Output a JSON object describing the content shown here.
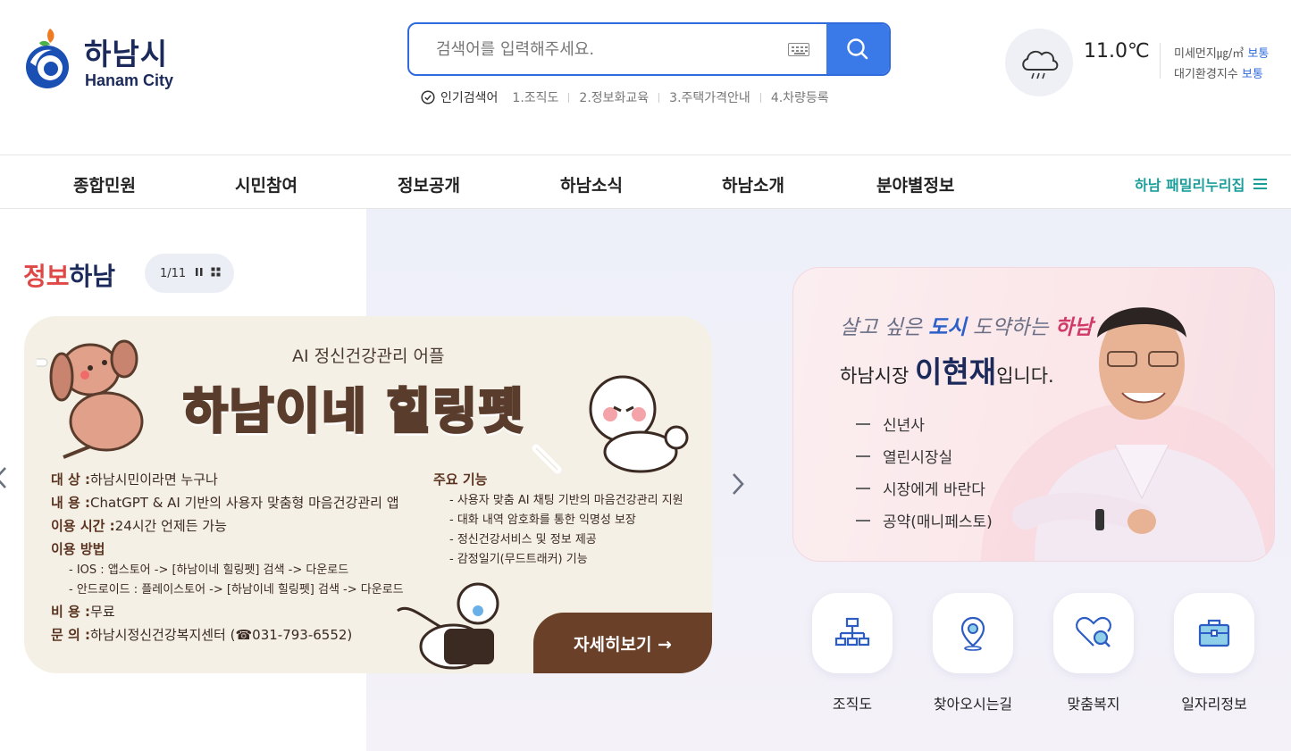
{
  "header": {
    "logo_text": "하남시",
    "logo_sub": "Hanam City",
    "search": {
      "placeholder": "검색어를 입력해주세요.",
      "popular_label": "인기검색어",
      "popular_keywords": [
        "1.조직도",
        "2.정보화교육",
        "3.주택가격안내",
        "4.차량등록"
      ]
    },
    "weather": {
      "temperature": "11.0℃",
      "fine_dust_label": "미세먼지㎍/㎥",
      "fine_dust_status": "보통",
      "air_index_label": "대기환경지수",
      "air_index_status": "보통"
    }
  },
  "nav": {
    "items": [
      "종합민원",
      "시민참여",
      "정보공개",
      "하남소식",
      "하남소개",
      "분야별정보"
    ],
    "family_link": "하남 패밀리누리집"
  },
  "info_section": {
    "title_red": "정보",
    "title_rest": "하남",
    "pager": "1/11",
    "banner": {
      "subtitle": "AI 정신건강관리 어플",
      "title": "하남이네 힐링펫",
      "lines": [
        {
          "key": "대    상 :",
          "value": "하남시민이라면 누구나"
        },
        {
          "key": "내    용 :",
          "value": "ChatGPT & AI 기반의 사용자 맞춤형 마음건강관리 앱"
        },
        {
          "key": "이용 시간 :",
          "value": "24시간 언제든 가능"
        },
        {
          "key": "이용 방법",
          "value": ""
        }
      ],
      "method_lines": [
        "- IOS : 앱스토어 -> [하남이네 힐링펫] 검색 -> 다운로드",
        "- 안드로이드 : 플레이스토어 -> [하남이네 힐링펫] 검색 -> 다운로드"
      ],
      "lines2": [
        {
          "key": "비    용 :",
          "value": "무료"
        },
        {
          "key": "문    의 :",
          "value": "하남시정신건강복지센터 (☎031-793-6552)"
        }
      ],
      "features_title": "주요 기능",
      "features": [
        "- 사용자 맞춤 AI 채팅 기반의 마음건강관리 지원",
        "- 대화 내역 암호화를 통한 익명성 보장",
        "- 정신건강서비스 및 정보 제공",
        "- 감정일기(무드트래커) 기능"
      ],
      "more_label": "자세히보기 →"
    }
  },
  "mayor": {
    "slogan_a": "살고 싶은 ",
    "slogan_b": "도시",
    "slogan_c": " 도약하는 ",
    "slogan_d": "하남",
    "intro_a": "하남시장 ",
    "intro_name": "이현재",
    "intro_b": "입니다.",
    "links": [
      "신년사",
      "열린시장실",
      "시장에게 바란다",
      "공약(매니페스토)"
    ]
  },
  "quick_links": [
    {
      "label": "조직도",
      "icon": "org-chart-icon"
    },
    {
      "label": "찾아오시는길",
      "icon": "location-pin-icon"
    },
    {
      "label": "맞춤복지",
      "icon": "heart-search-icon"
    },
    {
      "label": "일자리정보",
      "icon": "briefcase-icon"
    }
  ],
  "colors": {
    "brand_navy": "#1b2a5a",
    "search_blue": "#3a7ae8",
    "accent_teal": "#1a9e9a",
    "accent_red": "#e04848",
    "banner_brown": "#6b4028"
  }
}
